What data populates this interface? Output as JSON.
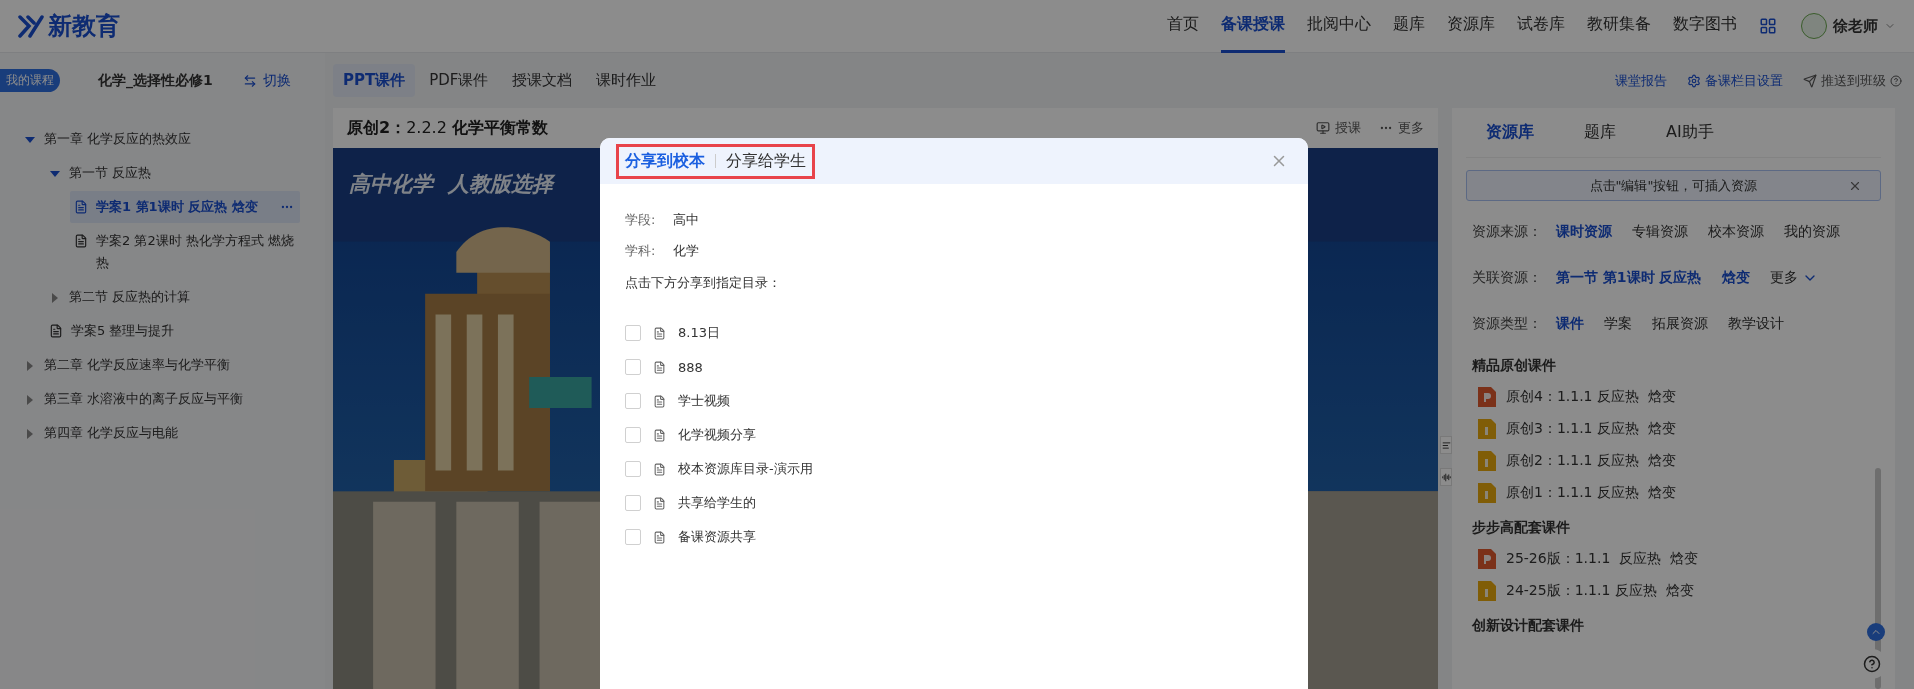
{
  "header": {
    "logo_text": "新教育",
    "nav": [
      {
        "label": "首页",
        "selected": false
      },
      {
        "label": "备课授课",
        "selected": true
      },
      {
        "label": "批阅中心",
        "selected": false
      },
      {
        "label": "题库",
        "selected": false
      },
      {
        "label": "资源库",
        "selected": false
      },
      {
        "label": "试卷库",
        "selected": false
      },
      {
        "label": "教研集备",
        "selected": false
      },
      {
        "label": "数字图书",
        "selected": false
      }
    ],
    "user": "徐老师"
  },
  "course_bar": {
    "badge": "我的课程",
    "title": "化学_选择性必修1",
    "switch": "切换"
  },
  "tree": [
    {
      "kind": "chapter",
      "label": "第一章 化学反应的热效应",
      "expanded": true,
      "children": [
        {
          "kind": "chapter",
          "label": "第一节 反应热",
          "expanded": true,
          "children": [
            {
              "kind": "doc",
              "label": "学案1 第1课时 反应热 焓变",
              "selected": true
            },
            {
              "kind": "doc",
              "label": "学案2 第2课时 热化学方程式 燃烧热",
              "selected": false
            }
          ]
        },
        {
          "kind": "chapter",
          "label": "第二节 反应热的计算",
          "expanded": false
        },
        {
          "kind": "doc",
          "label": "学案5 整理与提升",
          "selected": false
        }
      ]
    },
    {
      "kind": "chapter",
      "label": "第二章 化学反应速率与化学平衡",
      "expanded": false
    },
    {
      "kind": "chapter",
      "label": "第三章 水溶液中的离子反应与平衡",
      "expanded": false
    },
    {
      "kind": "chapter",
      "label": "第四章 化学反应与电能",
      "expanded": false
    }
  ],
  "content_tabs": [
    {
      "label": "PPT课件",
      "selected": true
    },
    {
      "label": "PDF课件",
      "selected": false
    },
    {
      "label": "授课文档",
      "selected": false
    },
    {
      "label": "课时作业",
      "selected": false
    }
  ],
  "toolbar_links": [
    "课堂报告",
    "备课栏目设置",
    "推送到班级"
  ],
  "viewer": {
    "title": "**原创2：**2.2.2 **化学平衡常数**",
    "actions": [
      "授课",
      "更多"
    ],
    "slide_title": "高中化学  人教版选择"
  },
  "modal": {
    "tabs": [
      {
        "label": "分享到校本",
        "selected": true
      },
      {
        "label": "分享给学生",
        "selected": false
      }
    ],
    "tabs_highlighted": true,
    "fields": [
      {
        "label": "学段:",
        "value": "高中"
      },
      {
        "label": "学科:",
        "value": "化学"
      }
    ],
    "instruction": "点击下方分享到指定目录：",
    "folders": [
      {
        "label": "8.13日",
        "checked": false
      },
      {
        "label": "888",
        "checked": false
      },
      {
        "label": "学士视频",
        "checked": false
      },
      {
        "label": "化学视频分享",
        "checked": false
      },
      {
        "label": "校本资源库目录-演示用",
        "checked": false
      },
      {
        "label": "共享给学生的",
        "checked": false
      },
      {
        "label": "备课资源共享",
        "checked": false
      }
    ]
  },
  "resource_panel": {
    "tabs": [
      {
        "label": "资源库",
        "selected": true
      },
      {
        "label": "题库",
        "selected": false
      },
      {
        "label": "AI助手",
        "selected": false
      }
    ],
    "notice": "点击\"编辑\"按钮，可插入资源",
    "filters": [
      {
        "label": "资源来源：",
        "options": [
          {
            "label": "课时资源",
            "selected": true
          },
          {
            "label": "专辑资源",
            "selected": false
          },
          {
            "label": "校本资源",
            "selected": false
          },
          {
            "label": "我的资源",
            "selected": false
          }
        ]
      },
      {
        "label": "关联资源：",
        "options": [
          {
            "label": "第一节 第1课时 反应热",
            "selected": true
          },
          {
            "label": "焓变",
            "selected": true
          }
        ],
        "more": "更多"
      },
      {
        "label": "资源类型：",
        "options": [
          {
            "label": "课件",
            "selected": true
          },
          {
            "label": "学案",
            "selected": false
          },
          {
            "label": "拓展资源",
            "selected": false
          },
          {
            "label": "教学设计",
            "selected": false
          }
        ]
      }
    ],
    "sections": [
      {
        "title": "精品原创课件",
        "items": [
          {
            "kind": "ppt",
            "label": "原创4：1.1.1 反应热  焓变"
          },
          {
            "kind": "archive",
            "label": "原创3：1.1.1 反应热  焓变"
          },
          {
            "kind": "archive",
            "label": "原创2：1.1.1 反应热  焓变"
          },
          {
            "kind": "archive",
            "label": "原创1：1.1.1 反应热  焓变"
          }
        ]
      },
      {
        "title": "步步高配套课件",
        "items": [
          {
            "kind": "ppt",
            "label": "25-26版：1.1.1  反应热  焓变"
          },
          {
            "kind": "archive",
            "label": "24-25版：1.1.1 反应热  焓变"
          }
        ]
      },
      {
        "title": "创新设计配套课件"
      }
    ]
  }
}
